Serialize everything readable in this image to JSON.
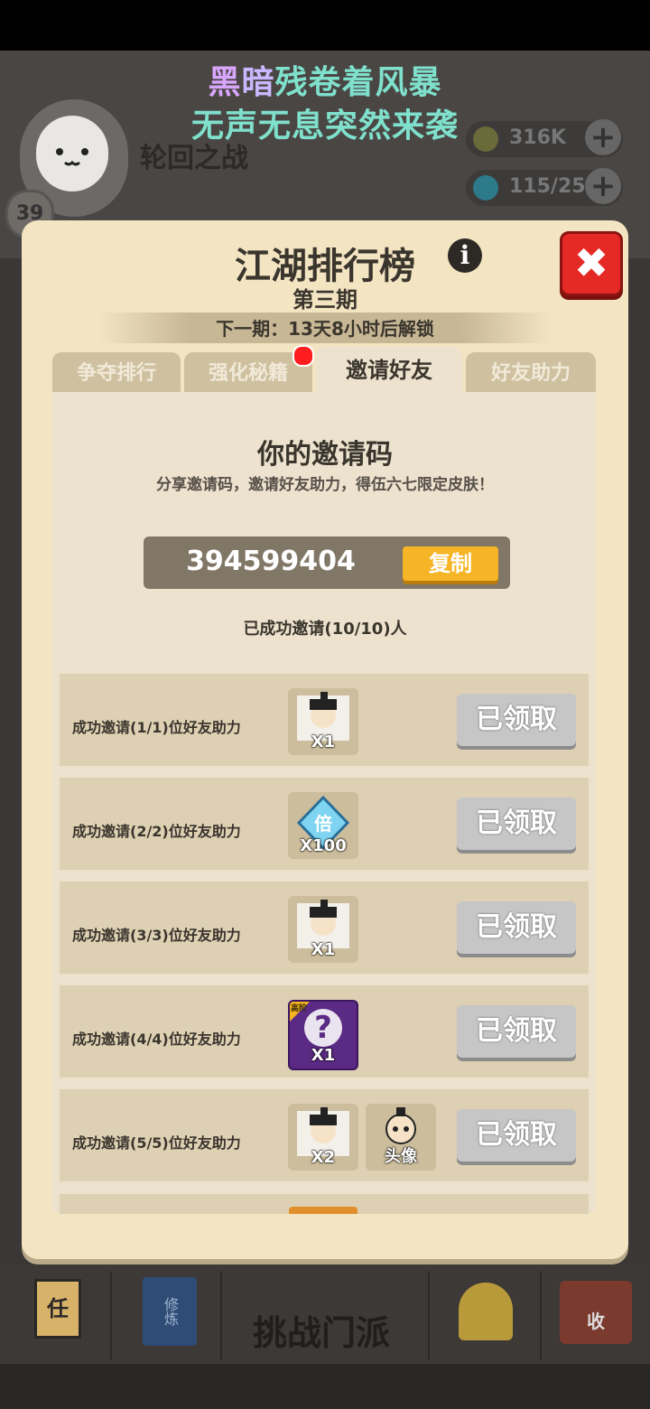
{
  "news": {
    "line1_hi": "黑",
    "line1_mid": "暗",
    "line1_rest": "残卷着风暴",
    "line2": "无声无息突然来袭"
  },
  "header": {
    "banner": "轮回之战",
    "level": "39",
    "currencies": [
      {
        "name": "coin",
        "value": "316K",
        "color": "#6a6a3a"
      },
      {
        "name": "gem",
        "value": "115/25",
        "color": "#2c7a8a"
      }
    ]
  },
  "dialog": {
    "title": "江湖排行榜",
    "period": "第三期",
    "next_unlock": "下一期：13天8小时后解锁",
    "close_icon": "close-icon",
    "tabs": [
      {
        "label": "争夺排行",
        "active": false
      },
      {
        "label": "强化秘籍",
        "active": false,
        "badge": true
      },
      {
        "label": "邀请好友",
        "active": true
      },
      {
        "label": "好友助力",
        "active": false
      }
    ],
    "invite": {
      "heading": "你的邀请码",
      "description": "分享邀请码，邀请好友助力，得伍六七限定皮肤！",
      "code": "394599404",
      "copy_label": "复制",
      "invited_status": "已成功邀请(10/10)人"
    },
    "rewards": [
      {
        "label": "成功邀请(1/1)位好友助力",
        "items": [
          {
            "icon": "character-fragment-icon",
            "qty": "X1"
          }
        ],
        "button": "已领取"
      },
      {
        "label": "成功邀请(2/2)位好友助力",
        "items": [
          {
            "icon": "multiplier-gem-icon",
            "glyph": "倍",
            "qty": "X100"
          }
        ],
        "button": "已领取"
      },
      {
        "label": "成功邀请(3/3)位好友助力",
        "items": [
          {
            "icon": "character-fragment-icon",
            "qty": "X1"
          }
        ],
        "button": "已领取"
      },
      {
        "label": "成功邀请(4/4)位好友助力",
        "items": [
          {
            "icon": "mystery-box-icon",
            "glyph": "?",
            "tag": "高阶",
            "qty": "X1"
          }
        ],
        "button": "已领取"
      },
      {
        "label": "成功邀请(5/5)位好友助力",
        "items": [
          {
            "icon": "character-fragment-icon",
            "qty": "X2"
          },
          {
            "icon": "avatar-frame-icon",
            "qty": "头像"
          }
        ],
        "button": "已领取"
      }
    ]
  },
  "bottom_nav": {
    "center_label": "挑战门派",
    "left_icon_glyph": "任",
    "book_glyph": "修炼",
    "right_icon_glyph": "收"
  }
}
